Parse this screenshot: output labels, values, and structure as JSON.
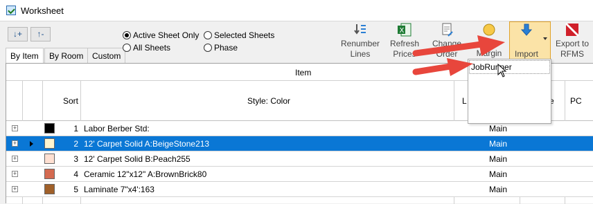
{
  "window": {
    "title": "Worksheet"
  },
  "sort_buttons": {
    "ascending": "↓+",
    "descending": "↑-"
  },
  "tabs": [
    "By Item",
    "By Room",
    "Custom"
  ],
  "scope_options": [
    {
      "label": "Active Sheet Only",
      "selected": true
    },
    {
      "label": "Selected Sheets",
      "selected": false
    },
    {
      "label": "All Sheets",
      "selected": false
    },
    {
      "label": "Phase",
      "selected": false
    }
  ],
  "toolbar": {
    "renumber_lines": "Renumber Lines",
    "refresh_prices": "Refresh Prices",
    "change_order": "Change Order",
    "margin": "Margin",
    "import": "Import",
    "export_to_rfms": "Export to RFMS"
  },
  "import_menu": {
    "items": [
      "JobRunner"
    ]
  },
  "grid": {
    "group_header": "Item",
    "columns": {
      "sort": "Sort",
      "style_color": "Style: Color",
      "l": "L",
      "e": "e",
      "pc": "PC"
    },
    "rows": [
      {
        "sort": "1",
        "style": "Labor Berber Std:",
        "location": "Main",
        "color": "#000000",
        "selected": false
      },
      {
        "sort": "2",
        "style": "12' Carpet Solid A:BeigeStone213",
        "location": "Main",
        "color": "#fff5d0",
        "selected": true
      },
      {
        "sort": "3",
        "style": "12' Carpet Solid B:Peach255",
        "location": "Main",
        "color": "#ffe0d2",
        "selected": false
      },
      {
        "sort": "4",
        "style": "Ceramic 12\"x12\" A:BrownBrick80",
        "location": "Main",
        "color": "#d46a50",
        "selected": false
      },
      {
        "sort": "5",
        "style": "Laminate 7\"x4':163",
        "location": "Main",
        "color": "#a0602a",
        "selected": false
      }
    ]
  },
  "colors": {
    "selection": "#0a77d5",
    "annotation_arrow": "#e8463c",
    "import_highlight": "#fbe3a7"
  }
}
